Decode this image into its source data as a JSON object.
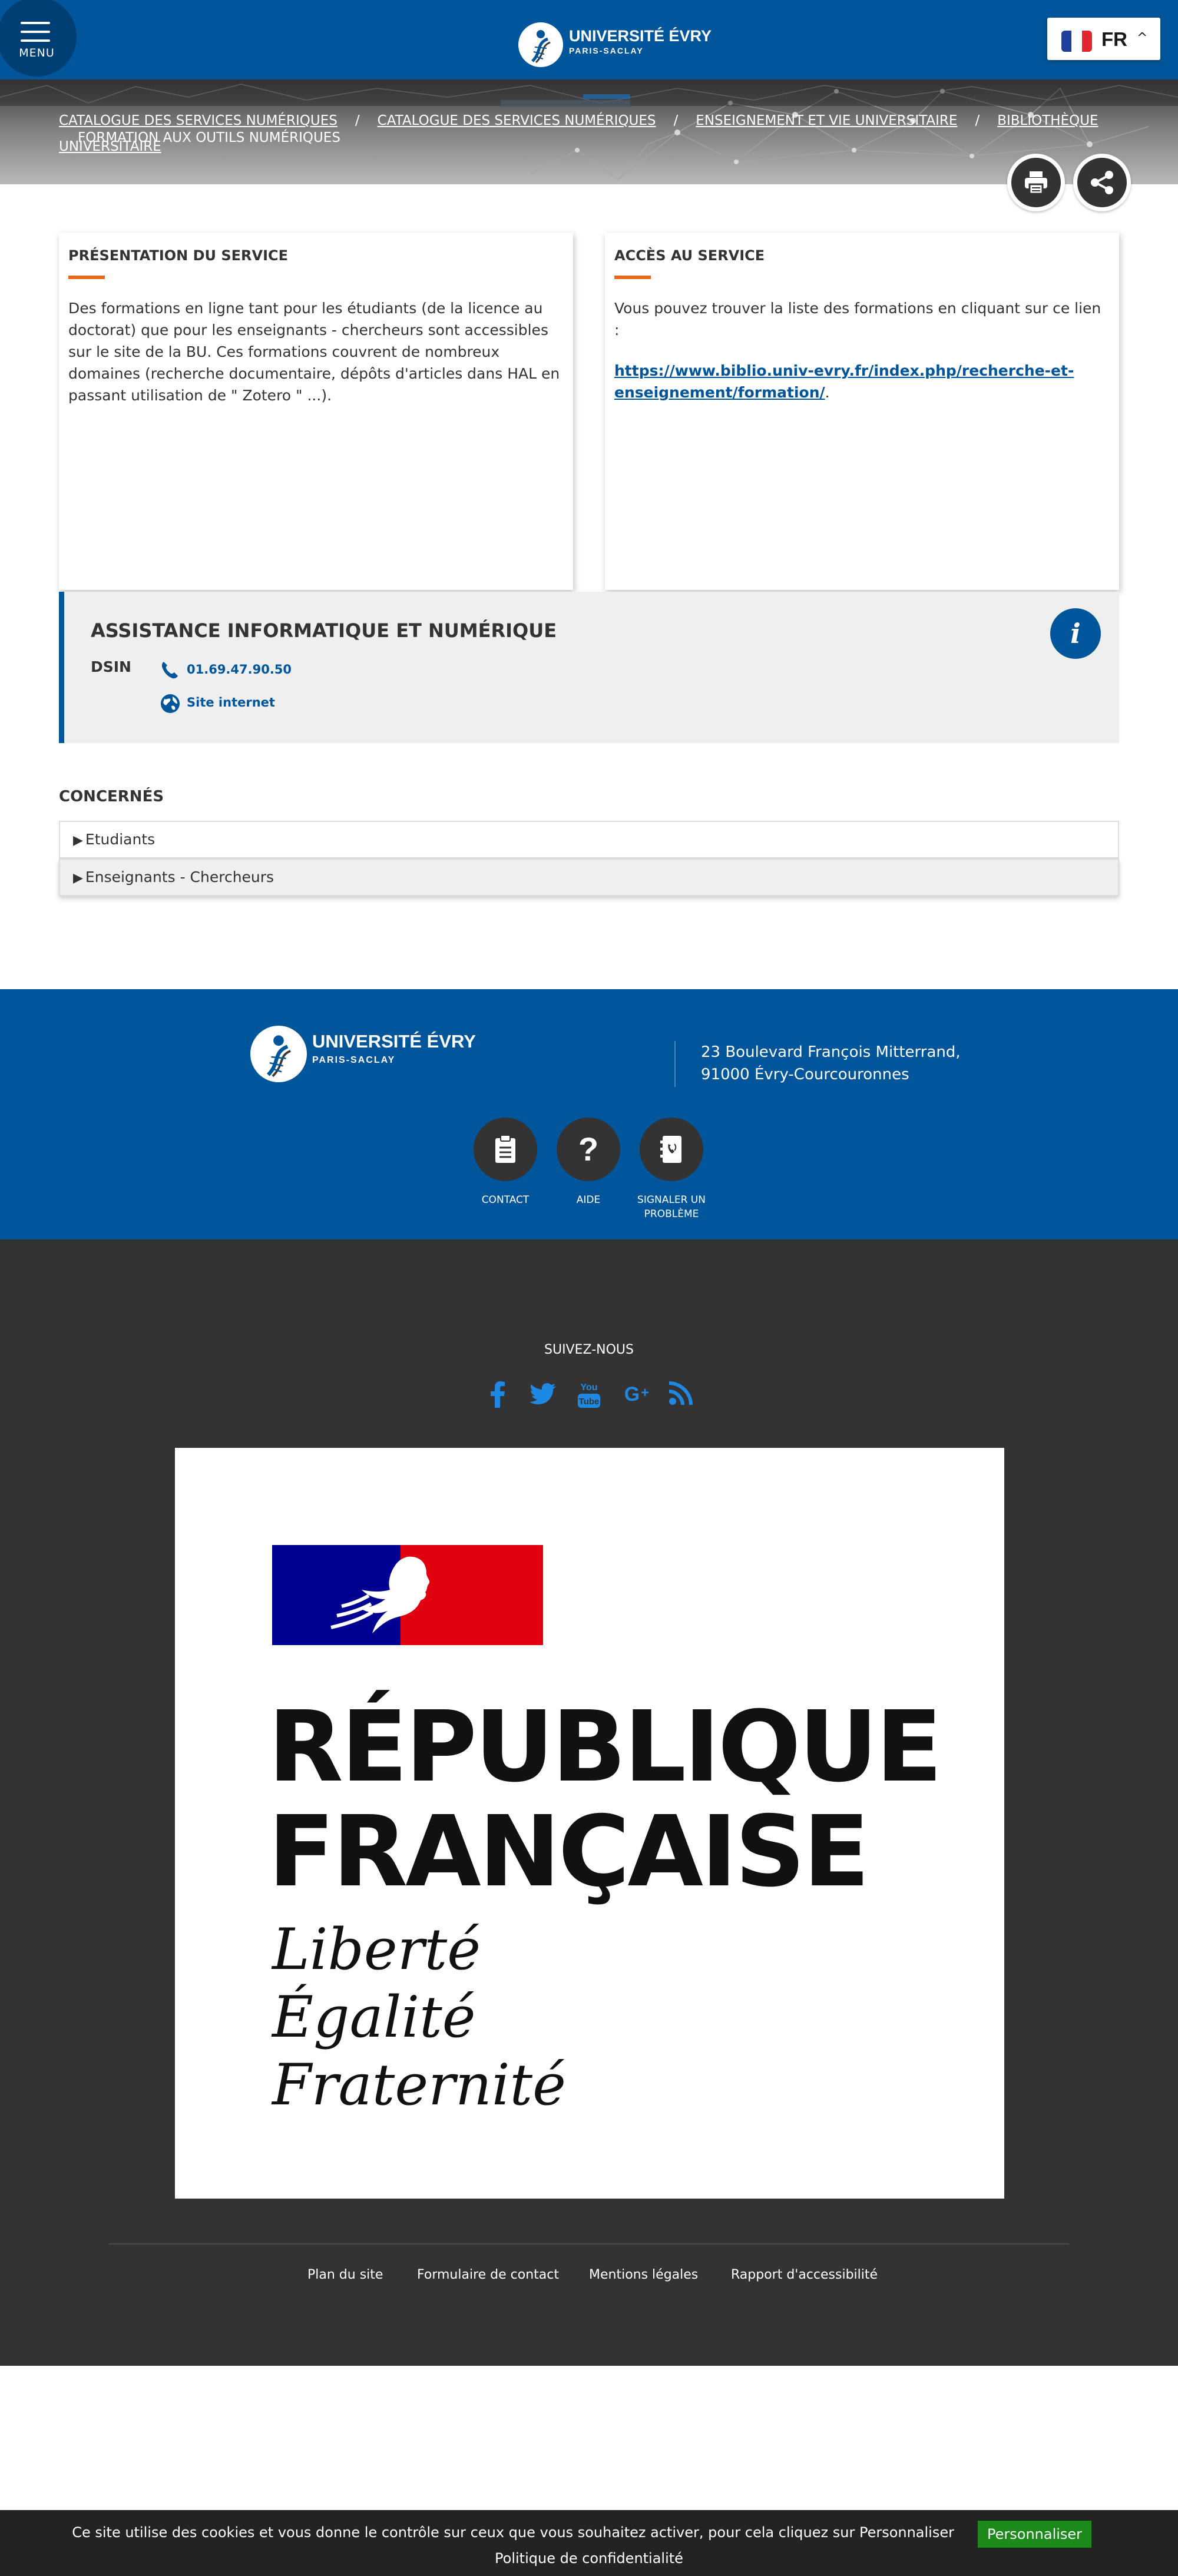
{
  "header": {
    "menu_label": "MENU",
    "logo_name": "UNIVERSITÉ ÉVRY",
    "logo_sub": "PARIS-SACLAY",
    "language": "FR",
    "accent_color": "#00559b"
  },
  "breadcrumb": {
    "items": [
      "CATALOGUE DES SERVICES NUMÉRIQUES",
      "CATALOGUE DES SERVICES NUMÉRIQUES",
      "ENSEIGNEMENT ET VIE UNIVERSITAIRE",
      "BIBLIOTHÈQUE UNIVERSITAIRE"
    ],
    "current": "FORMATION AUX OUTILS NUMÉRIQUES"
  },
  "actions": {
    "print_icon": "printer-icon",
    "share_icon": "share-icon"
  },
  "presentation": {
    "title": "PRÉSENTATION DU SERVICE",
    "body": "Des formations en ligne tant pour les étudiants (de la licence au doctorat) que pour les enseignants - chercheurs sont accessibles sur le site de la BU. Ces formations couvrent de nombreux domaines (recherche documentaire, dépôts d'articles dans HAL en passant utilisation de \" Zotero \" ...)."
  },
  "access": {
    "title": "ACCÈS AU SERVICE",
    "intro": "Vous pouvez trouver la liste des formations en cliquant sur ce lien :",
    "link_text": "https://www.biblio.univ-evry.fr/index.php/recherche-et-enseignement/formation/",
    "trailing": "."
  },
  "assistance": {
    "title": "ASSISTANCE INFORMATIQUE ET NUMÉRIQUE",
    "org": "DSIN",
    "phone": "01.69.47.90.50",
    "website_label": "Site internet",
    "info_glyph": "i"
  },
  "concernes": {
    "title": "CONCERNÉS",
    "items": [
      "Etudiants",
      "Enseignants - Chercheurs"
    ],
    "marker": "▶"
  },
  "footer": {
    "address_line1": "23 Boulevard François Mitterrand,",
    "address_line2": "91000 Évry-Courcouronnes",
    "actions": [
      {
        "label": "CONTACT",
        "icon": "clipboard-icon"
      },
      {
        "label": "AIDE",
        "icon": "question-icon"
      },
      {
        "label": "SIGNALER UN PROBLÈME",
        "icon": "contacts-book-icon"
      }
    ],
    "follow_label": "SUIVEZ-NOUS",
    "social": [
      "facebook-icon",
      "twitter-icon",
      "youtube-icon",
      "google-plus-icon",
      "rss-icon"
    ],
    "republique_line1": "RÉPUBLIQUE",
    "republique_line2": "FRANÇAISE",
    "motto": [
      "Liberté",
      "Égalité",
      "Fraternité"
    ],
    "links": [
      "Plan du site",
      "Formulaire de contact",
      "Mentions légales",
      "Rapport d'accessibilité"
    ]
  },
  "cookie": {
    "text": "Ce site utilise des cookies et vous donne le contrôle sur ceux que vous souhaitez activer, pour cela cliquez sur Personnaliser",
    "button": "Personnaliser",
    "policy": "Politique de confidentialité"
  }
}
